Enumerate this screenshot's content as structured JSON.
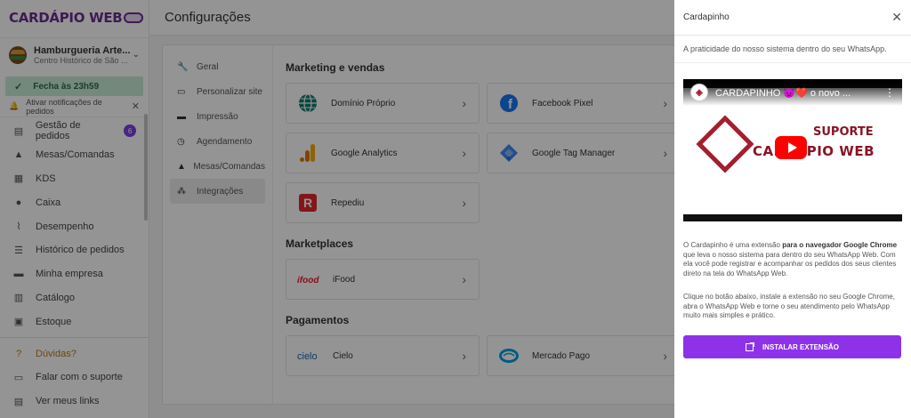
{
  "app": {
    "logo": "CARDÁPIO WEB",
    "store_name": "Hamburgueria Arte...",
    "store_address": "Centro Histórico de São ...",
    "open_status": "Fecha às 23h59",
    "notifications_prompt": "Ativar notificações de pedidos"
  },
  "sidebar": {
    "items": [
      {
        "label": "Gestão de pedidos",
        "icon": "orders-icon",
        "badge": "6"
      },
      {
        "label": "Mesas/Comandas",
        "icon": "tables-icon"
      },
      {
        "label": "KDS",
        "icon": "kds-icon"
      },
      {
        "label": "Caixa",
        "icon": "cash-icon"
      },
      {
        "label": "Desempenho",
        "icon": "chart-icon"
      },
      {
        "label": "Histórico de pedidos",
        "icon": "history-icon"
      },
      {
        "label": "Minha empresa",
        "icon": "store-icon"
      },
      {
        "label": "Catálogo",
        "icon": "catalog-icon"
      },
      {
        "label": "Estoque",
        "icon": "stock-icon"
      }
    ],
    "help_items": [
      {
        "label": "Dúvidas?",
        "icon": "help-icon"
      },
      {
        "label": "Falar com o suporte",
        "icon": "chat-icon"
      },
      {
        "label": "Ver meus links",
        "icon": "links-icon"
      }
    ]
  },
  "page": {
    "title": "Configurações"
  },
  "settings_menu": {
    "items": [
      {
        "label": "Geral",
        "icon": "wrench-icon"
      },
      {
        "label": "Personalizar site",
        "icon": "browser-icon"
      },
      {
        "label": "Impressão",
        "icon": "printer-icon"
      },
      {
        "label": "Agendamento",
        "icon": "clock-icon"
      },
      {
        "label": "Mesas/Comandas",
        "icon": "tables-icon"
      },
      {
        "label": "Integrações",
        "icon": "integrations-icon",
        "active": true
      }
    ]
  },
  "integrations": {
    "sections": [
      {
        "title": "Marketing e vendas",
        "cards": [
          {
            "label": "Domínio Próprio",
            "logo": "globe-logo"
          },
          {
            "label": "Facebook Pixel",
            "logo": "facebook-logo"
          },
          {
            "label": "Google Analytics",
            "logo": "google-analytics-logo"
          },
          {
            "label": "Google Tag Manager",
            "logo": "google-tag-manager-logo"
          },
          {
            "label": "Repediu",
            "logo": "repediu-logo"
          }
        ]
      },
      {
        "title": "Marketplaces",
        "cards": [
          {
            "label": "iFood",
            "logo": "ifood-logo"
          }
        ]
      },
      {
        "title": "Pagamentos",
        "cards": [
          {
            "label": "Cielo",
            "logo": "cielo-logo"
          },
          {
            "label": "Mercado Pago",
            "logo": "mercado-pago-logo"
          }
        ]
      }
    ]
  },
  "drawer": {
    "title": "Cardapinho",
    "subtitle": "A praticidade do nosso sistema dentro do seu WhatsApp.",
    "video": {
      "title": "CARDAPINHO 😈❤️ o novo ...",
      "frame_text_1": "SUPORTE",
      "frame_text_2": "CARDÁPIO WEB"
    },
    "desc_1_a": "O Cardapinho é uma extensão ",
    "desc_1_b": "para o navegador Google Chrome",
    "desc_1_c": " que leva o nosso sistema para dentro do seu WhatsApp Web. Com ela você pode registrar e acompanhar os pedidos dos seus clientes direto na tela do WhatsApp Web.",
    "desc_2": "Clique no botão abaixo, instale a extensão no seu Google Chrome, abra o WhatsApp Web e torne o seu atendimento pelo WhatsApp muito mais simples e prático.",
    "install_label": "INSTALAR EXTENSÃO"
  },
  "colors": {
    "brand": "#6b2d8f",
    "accent": "#8e32e9",
    "open_bg": "#c9ecd6",
    "badge": "#7b3fe4",
    "help": "#c0761c"
  }
}
